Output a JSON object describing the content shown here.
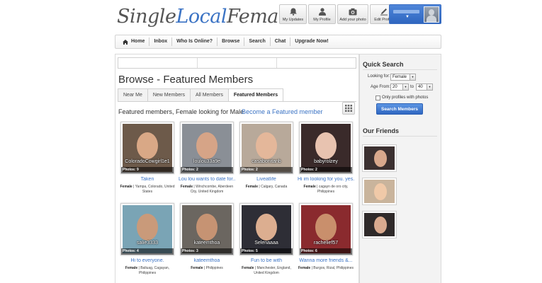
{
  "header": {
    "logo": {
      "part1": "Single",
      "part2": "Local",
      "part3": "Females"
    },
    "buttons": [
      {
        "label": "My Updates",
        "icon": "bell-icon"
      },
      {
        "label": "My Profile",
        "icon": "person-icon"
      },
      {
        "label": "Add your photo",
        "icon": "camera-icon"
      },
      {
        "label": "Edit Profile",
        "icon": "pencil-icon"
      }
    ],
    "user_menu": {
      "caret": "▼"
    }
  },
  "nav": {
    "items": [
      "Home",
      "Inbox",
      "Who Is Online?",
      "Browse",
      "Search",
      "Chat",
      "Upgrade Now!"
    ]
  },
  "main": {
    "title": "Browse - Featured Members",
    "tabs": [
      "Near Me",
      "New Members",
      "All Members",
      "Featured Members"
    ],
    "active_tab": "Featured Members",
    "subtitle": "Featured members, Female looking for Male",
    "become_link": "Become a Featured member",
    "members": [
      {
        "username": "ColoradoCowgirl1e1",
        "photos": "Photos: 9",
        "headline": "Taken",
        "gender": "Female",
        "location": "Yampa, Colorado, United States",
        "bg": "#6d5a4a",
        "skin": "#d9a886"
      },
      {
        "username": "loulou33a9e",
        "photos": "Photos: 2",
        "headline": "Lou lou wants to date for...",
        "gender": "Female",
        "location": "Winchcombe, Aberdeen City, United Kingdom",
        "bg": "#8a8f96",
        "skin": "#d6a487"
      },
      {
        "username": "casabonitanb",
        "photos": "Photos: 2",
        "headline": "Liveatlife",
        "gender": "Female",
        "location": "Calgary, Canada",
        "bg": "#b8a99a",
        "skin": "#e4b79a"
      },
      {
        "username": "babyrolzey",
        "photos": "Photos: 2",
        "headline": "Hi im looking for you. yes...",
        "gender": "Female",
        "location": "cagayn de oro city, Philippines",
        "bg": "#3a2a2a",
        "skin": "#e8c3b0"
      },
      {
        "username": "salie3333",
        "photos": "Photos: 4",
        "headline": "Hi to everyone.",
        "gender": "Female",
        "location": "Baliuag, Cagayan, Philippines",
        "bg": "#7aa4b5",
        "skin": "#c99a7a"
      },
      {
        "username": "kateemthoa",
        "photos": "Photos: 3",
        "headline": "kateemthoa",
        "gender": "Female",
        "location": "Philippines",
        "bg": "#6b6660",
        "skin": "#c69373"
      },
      {
        "username": "Selenaaaa",
        "photos": "Photos: 5",
        "headline": "Fun to be with",
        "gender": "Female",
        "location": "Manchester, England, United Kingdom",
        "bg": "#2e2e36",
        "skin": "#dcae90"
      },
      {
        "username": "rachelief57",
        "photos": "Photos: 6",
        "headline": "Wanna more friends &...",
        "gender": "Female",
        "location": "Burgos, Rizal, Philippines",
        "bg": "#8a2a2e",
        "skin": "#c98f6c"
      }
    ]
  },
  "sidebar": {
    "quick_search": {
      "title": "Quick Search",
      "looking_for_label": "Looking for:",
      "looking_for_value": "Female",
      "age_from_label": "Age From:",
      "age_from": "20",
      "age_to_label": "to",
      "age_to": "40",
      "photos_only_label": "Only profiles with photos",
      "button": "Search Members"
    },
    "friends": {
      "title": "Our Friends",
      "items": [
        {
          "name": "friend-1",
          "bg": "#3b3030",
          "skin": "#d8a88c"
        },
        {
          "name": "friend-2",
          "bg": "#c9b49c",
          "skin": "#f0c9a8"
        },
        {
          "name": "friend-3",
          "bg": "#2f2a2a",
          "skin": "#d9aa8f"
        }
      ]
    }
  },
  "colors": {
    "accent": "#3b73c4",
    "button": "#2f67c1"
  }
}
